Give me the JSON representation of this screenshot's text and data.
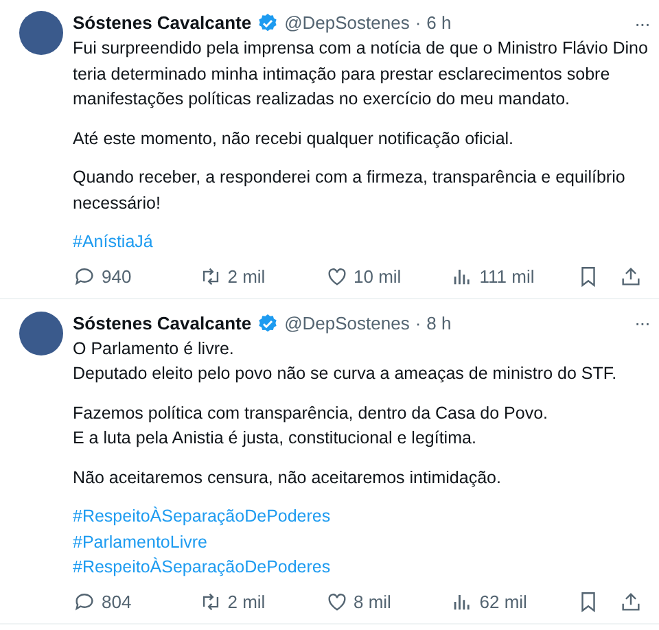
{
  "tweets": [
    {
      "name": "Sóstenes Cavalcante",
      "verified": true,
      "handle": "@DepSostenes",
      "separator": "·",
      "time": "6 h",
      "more": "···",
      "paragraphs": [
        {
          "kind": "text",
          "lines": [
            "Fui surpreendido pela imprensa com a notícia de que o Ministro Flávio Dino",
            "teria determinado minha intimação para prestar esclarecimentos sobre",
            "manifestações políticas realizadas no exercício do meu mandato."
          ]
        },
        {
          "kind": "text",
          "lines": [
            "Até este momento, não recebi qualquer notificação oficial."
          ]
        },
        {
          "kind": "text",
          "lines": [
            "Quando receber, a responderei com a firmeza, transparência e equilíbrio",
            "necessário!"
          ]
        },
        {
          "kind": "hashtag",
          "lines": [
            "#AnístiaJá"
          ]
        }
      ],
      "stats": {
        "replies": "940",
        "reposts": "2 mil",
        "likes": "10 mil",
        "views": "111 mil"
      }
    },
    {
      "name": "Sóstenes Cavalcante",
      "verified": true,
      "handle": "@DepSostenes",
      "separator": "·",
      "time": "8 h",
      "more": "···",
      "paragraphs": [
        {
          "kind": "text",
          "lines": [
            "O Parlamento é livre.",
            "Deputado eleito pelo povo não se curva a ameaças de ministro do STF."
          ]
        },
        {
          "kind": "text",
          "lines": [
            "Fazemos política com transparência, dentro da Casa do Povo.",
            "E a luta pela Anistia é justa, constitucional e legítima."
          ]
        },
        {
          "kind": "text",
          "lines": [
            "Não aceitaremos censura, não aceitaremos intimidação."
          ]
        },
        {
          "kind": "hashtag",
          "lines": [
            "#RespeitoÀSeparaçãoDePoderes",
            "#ParlamentoLivre",
            "#RespeitoÀSeparaçãoDePoderes"
          ]
        }
      ],
      "stats": {
        "replies": "804",
        "reposts": "2 mil",
        "likes": "8 mil",
        "views": "62 mil"
      }
    }
  ]
}
